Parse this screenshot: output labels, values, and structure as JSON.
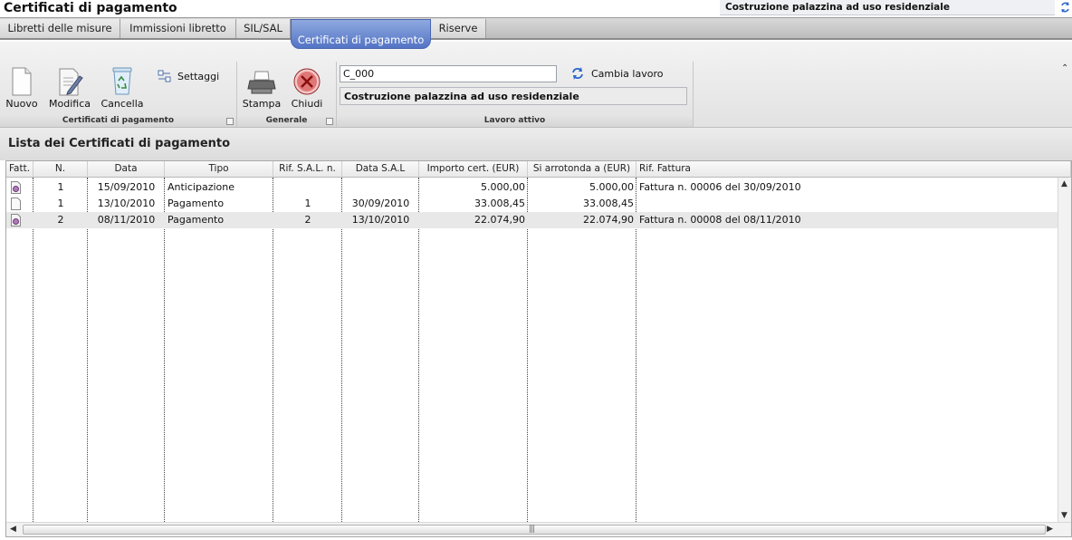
{
  "app": {
    "title": "Certificati di pagamento",
    "project_name": "Costruzione palazzina ad uso residenziale"
  },
  "tabs": [
    {
      "label": "Libretti delle misure",
      "active": false
    },
    {
      "label": "Immissioni libretto",
      "active": false
    },
    {
      "label": "SIL/SAL",
      "active": false
    },
    {
      "label": "Certificati di pagamento",
      "active": true
    },
    {
      "label": "Riserve",
      "active": false
    }
  ],
  "ribbon": {
    "group1": {
      "caption": "Certificati di pagamento",
      "nuovo": "Nuovo",
      "modifica": "Modifica",
      "cancella": "Cancella",
      "settaggi": "Settaggi"
    },
    "group2": {
      "caption": "Generale",
      "stampa": "Stampa",
      "chiudi": "Chiudi"
    },
    "group3": {
      "caption": "Lavoro attivo",
      "code_value": "C_000",
      "cambia_lavoro": "Cambia lavoro",
      "active_work": "Costruzione palazzina ad uso residenziale"
    }
  },
  "list": {
    "title": "Lista dei Certificati di pagamento",
    "columns": [
      "Fatt.",
      "N.",
      "Data",
      "Tipo",
      "Rif. S.A.L. n.",
      "Data S.A.L",
      "Importo cert. (EUR)",
      "Si arrotonda a (EUR)",
      "Rif. Fattura"
    ],
    "rows": [
      {
        "fatt_icon": "invoice-icon",
        "n": "1",
        "data": "15/09/2010",
        "tipo": "Anticipazione",
        "rif_sal": "",
        "data_sal": "",
        "importo": "5.000,00",
        "arrotonda": "5.000,00",
        "rif_fattura": "Fattura n. 00006 del 30/09/2010"
      },
      {
        "fatt_icon": "document-icon",
        "n": "1",
        "data": "13/10/2010",
        "tipo": "Pagamento",
        "rif_sal": "1",
        "data_sal": "30/09/2010",
        "importo": "33.008,45",
        "arrotonda": "33.008,45",
        "rif_fattura": ""
      },
      {
        "fatt_icon": "invoice-icon",
        "n": "2",
        "data": "08/11/2010",
        "tipo": "Pagamento",
        "rif_sal": "2",
        "data_sal": "13/10/2010",
        "importo": "22.074,90",
        "arrotonda": "22.074,90",
        "rif_fattura": "Fattura n. 00008 del 08/11/2010"
      }
    ]
  }
}
